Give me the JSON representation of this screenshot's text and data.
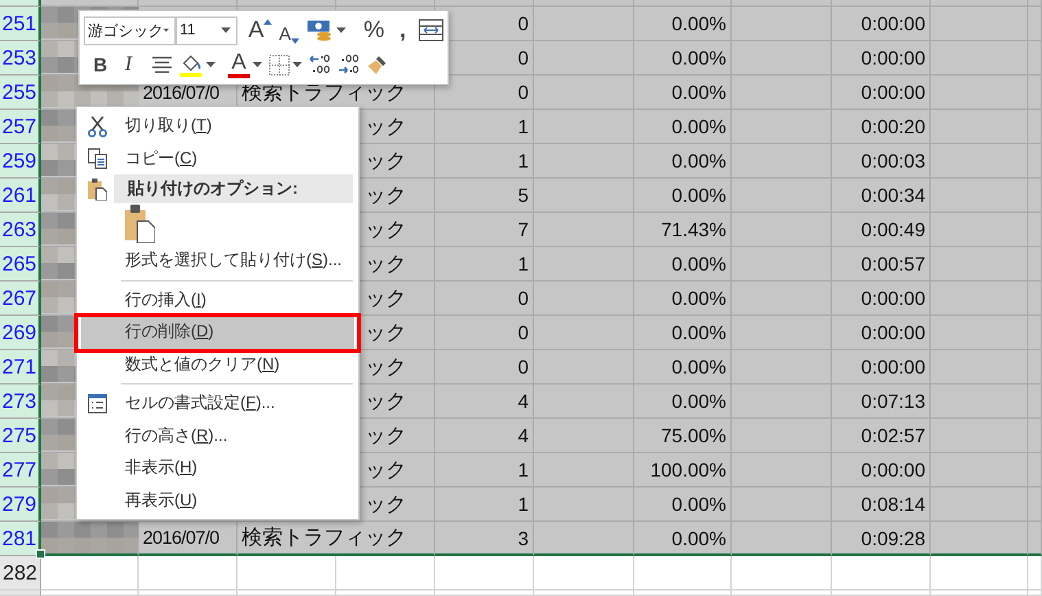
{
  "toolbar": {
    "font": "游ゴシック",
    "size": "11",
    "grow_label": "A",
    "shrink_label": "A",
    "percent": "%",
    "comma": ",",
    "bold": "B",
    "italic": "I",
    "font_color_label": "A"
  },
  "rows": [
    {
      "number": "251",
      "selected": true,
      "filtered": true,
      "value": "0",
      "rate": "0.00%",
      "time": "0:00:00"
    },
    {
      "number": "253",
      "selected": true,
      "filtered": true,
      "value": "0",
      "rate": "0.00%",
      "time": "0:00:00"
    },
    {
      "number": "255",
      "selected": true,
      "filtered": true,
      "date": "2016/07/0",
      "traffic": "検索トラフィック",
      "value": "0",
      "rate": "0.00%",
      "time": "0:00:00"
    },
    {
      "number": "257",
      "selected": true,
      "filtered": true,
      "traffic": "ック",
      "value": "1",
      "rate": "0.00%",
      "time": "0:00:20"
    },
    {
      "number": "259",
      "selected": true,
      "filtered": true,
      "traffic": "ック",
      "value": "1",
      "rate": "0.00%",
      "time": "0:00:03"
    },
    {
      "number": "261",
      "selected": true,
      "filtered": true,
      "traffic": "ック",
      "value": "5",
      "rate": "0.00%",
      "time": "0:00:34"
    },
    {
      "number": "263",
      "selected": true,
      "filtered": true,
      "traffic": "ック",
      "value": "7",
      "rate": "71.43%",
      "time": "0:00:49"
    },
    {
      "number": "265",
      "selected": true,
      "filtered": true,
      "traffic": "ック",
      "value": "1",
      "rate": "0.00%",
      "time": "0:00:57"
    },
    {
      "number": "267",
      "selected": true,
      "filtered": true,
      "traffic": "ック",
      "value": "0",
      "rate": "0.00%",
      "time": "0:00:00"
    },
    {
      "number": "269",
      "selected": true,
      "filtered": true,
      "traffic": "ック",
      "value": "0",
      "rate": "0.00%",
      "time": "0:00:00"
    },
    {
      "number": "271",
      "selected": true,
      "filtered": true,
      "traffic": "ック",
      "value": "0",
      "rate": "0.00%",
      "time": "0:00:00"
    },
    {
      "number": "273",
      "selected": true,
      "filtered": true,
      "traffic": "ック",
      "value": "4",
      "rate": "0.00%",
      "time": "0:07:13"
    },
    {
      "number": "275",
      "selected": true,
      "filtered": true,
      "traffic": "ック",
      "value": "4",
      "rate": "75.00%",
      "time": "0:02:57"
    },
    {
      "number": "277",
      "selected": true,
      "filtered": true,
      "traffic": "ック",
      "value": "1",
      "rate": "100.00%",
      "time": "0:00:00"
    },
    {
      "number": "279",
      "selected": true,
      "filtered": true,
      "traffic": "ック",
      "value": "1",
      "rate": "0.00%",
      "time": "0:08:14"
    },
    {
      "number": "281",
      "selected": true,
      "filtered": true,
      "date": "2016/07/0",
      "traffic": "検索トラフィック",
      "value": "3",
      "rate": "0.00%",
      "time": "0:09:28"
    },
    {
      "number": "282",
      "selected": false,
      "filtered": false
    }
  ],
  "context_menu": {
    "items": [
      {
        "kind": "command",
        "before": "切り取り(",
        "accel": "T",
        "after": ")",
        "selected": false,
        "highlighted": false
      },
      {
        "kind": "command",
        "before": "コピー(",
        "accel": "C",
        "after": ")",
        "selected": false,
        "highlighted": false
      },
      {
        "kind": "heading",
        "text": "貼り付けのオプション:"
      },
      {
        "kind": "paste-option"
      },
      {
        "kind": "command",
        "before": "形式を選択して貼り付け(",
        "accel": "S",
        "after": ")...",
        "selected": false,
        "highlighted": false
      },
      {
        "kind": "command",
        "before": "行の挿入(",
        "accel": "I",
        "after": ")",
        "selected": false,
        "highlighted": false,
        "separator_before": true
      },
      {
        "kind": "command",
        "before": "行の削除(",
        "accel": "D",
        "after": ")",
        "selected": true,
        "highlighted": true
      },
      {
        "kind": "command",
        "before": "数式と値のクリア(",
        "accel": "N",
        "after": ")",
        "selected": false,
        "highlighted": false
      },
      {
        "kind": "command",
        "before": "セルの書式設定(",
        "accel": "F",
        "after": ")...",
        "selected": false,
        "highlighted": false,
        "separator_before": true
      },
      {
        "kind": "command",
        "before": "行の高さ(",
        "accel": "R",
        "after": ")...",
        "selected": false,
        "highlighted": false
      },
      {
        "kind": "command",
        "before": "非表示(",
        "accel": "H",
        "after": ")",
        "selected": false,
        "highlighted": false
      },
      {
        "kind": "command",
        "before": "再表示(",
        "accel": "U",
        "after": ")",
        "selected": false,
        "highlighted": false
      }
    ]
  }
}
